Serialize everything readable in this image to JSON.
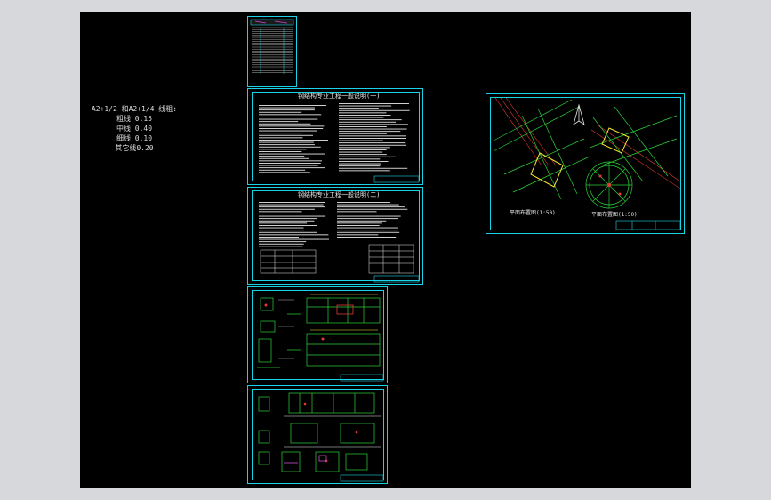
{
  "note": {
    "lines": [
      "A2+1/2 和A2+1/4 线粗:",
      "粗线  0.15",
      "中线  0.40",
      "细线  0.10",
      "其它线0.20"
    ]
  },
  "sheets": {
    "spec1_title": "钢结构专业工程一般说明(一)",
    "spec2_title": "钢结构专业工程一般说明(二)",
    "plan_label_left": "平面布置图(1:50)",
    "plan_label_right": "平面布置图(1:50)"
  },
  "colors": {
    "background": "#000000",
    "border": "#19d4e6",
    "drawing": "#2bd13a",
    "accent": "#e53935",
    "highlight": "#f2e530",
    "text": "#e8e8e8"
  }
}
